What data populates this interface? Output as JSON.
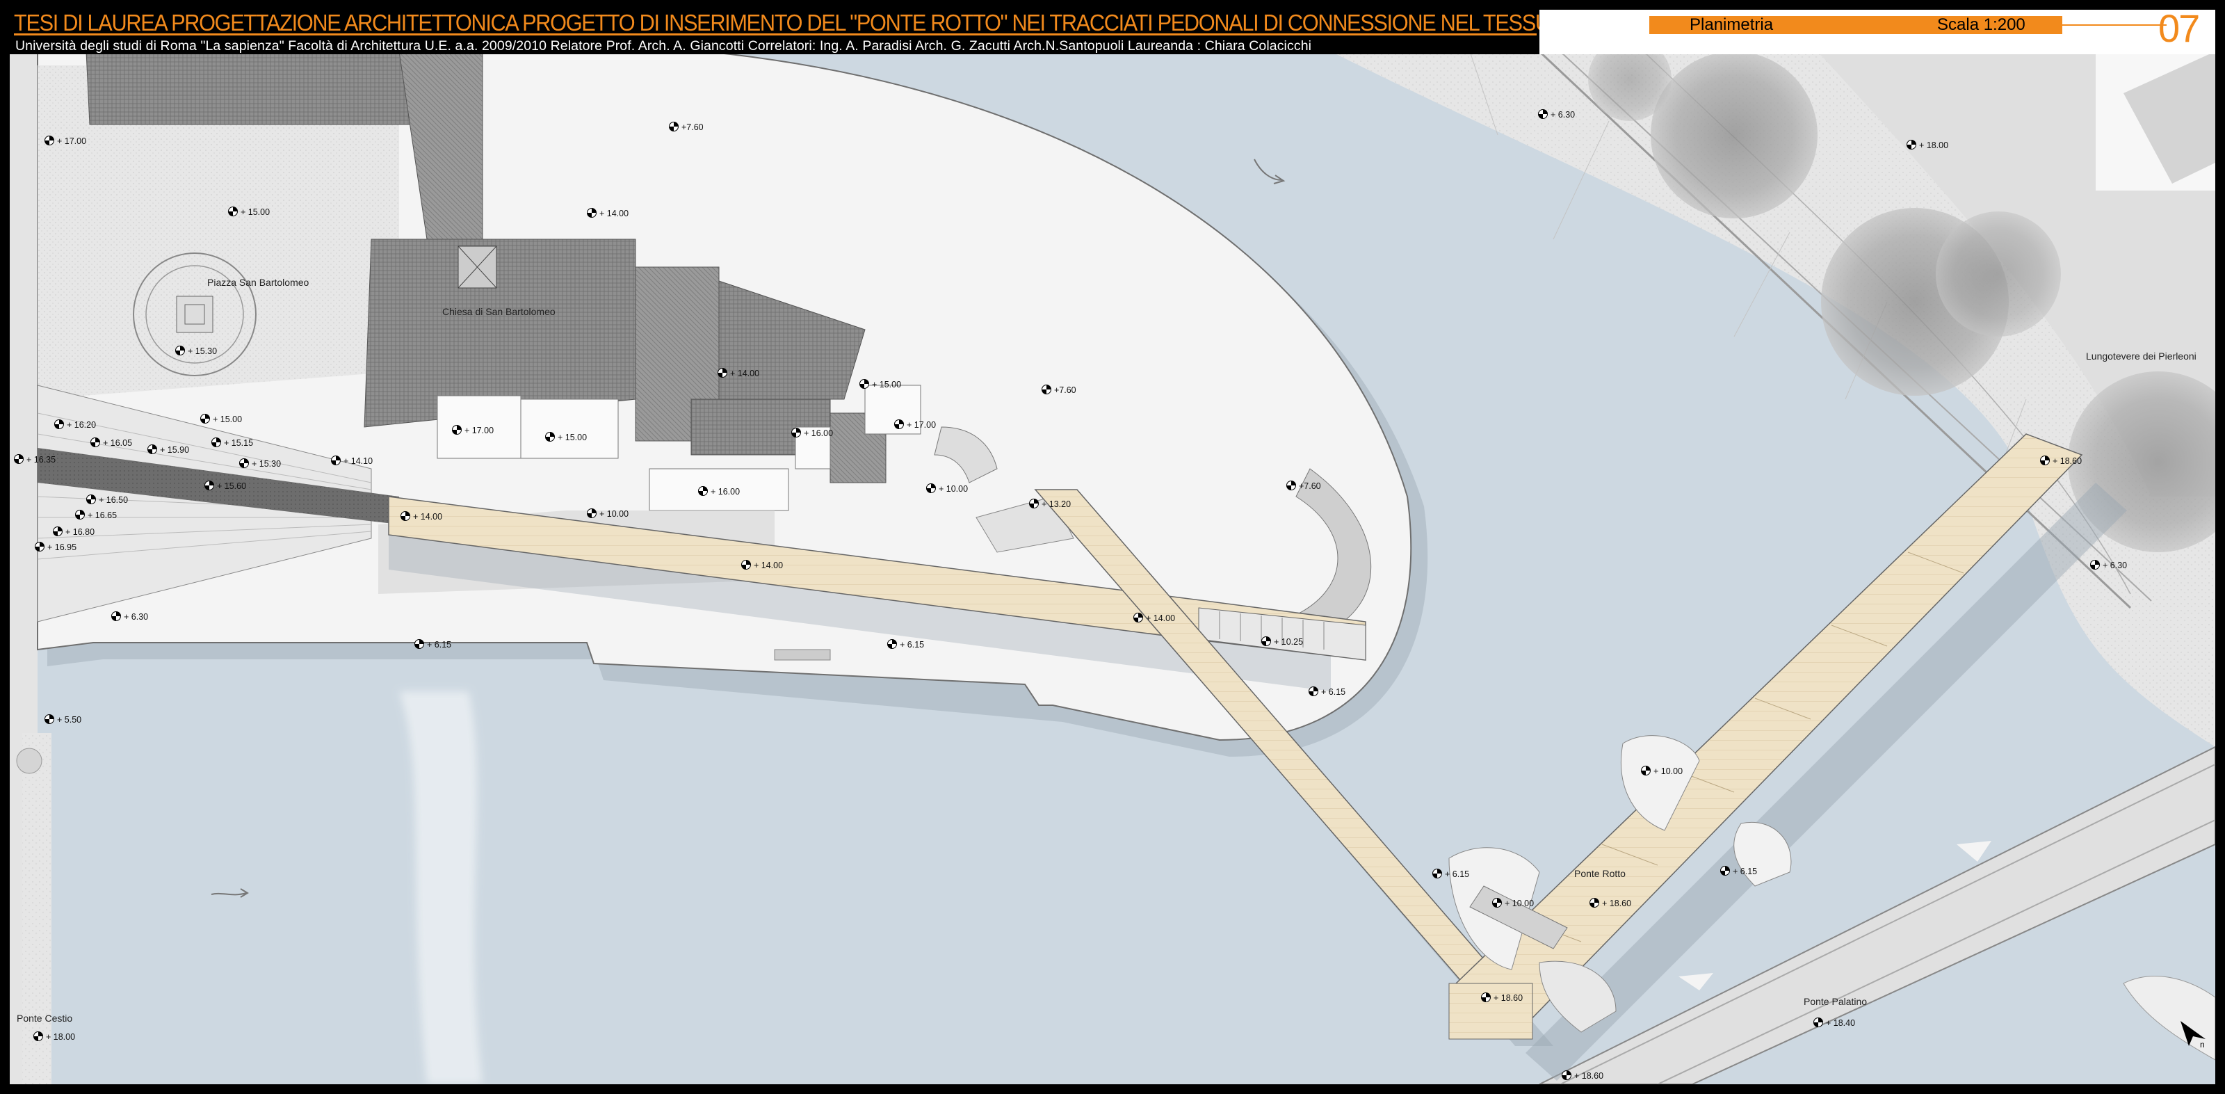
{
  "header": {
    "thesis_title": "TESI DI LAUREA   PROGETTAZIONE ARCHITETTONICA   PROGETTO DI INSERIMENTO DEL \"PONTE ROTTO\" NEI TRACCIATI PEDONALI DI CONNESSIONE NEL TESSUTO URBANO DI ROMA",
    "credits": "Università degli studi di Roma \"La sapienza\" Facoltà di Architettura U.E. a.a. 2009/2010   Relatore Prof. Arch. A. Giancotti   Correlatori:   Ing. A. Paradisi   Arch. G. Zacutti   Arch.N.Santopuoli    Laureanda : Chiara Colacicchi",
    "sheet_name": "Planimetria",
    "sheet_scale": "Scala 1:200",
    "sheet_number": "07"
  },
  "colors": {
    "accent": "#f28a1c",
    "water": "#cdd8e1",
    "island": "#f4f4f4",
    "roof": "#8e8e8e",
    "walkway": "#efe2c6"
  },
  "places": {
    "piazza": "Piazza San Bartolomeo",
    "chiesa": "Chiesa di San Bartolomeo",
    "lungotevere": "Lungotevere dei Pierleoni",
    "ponte_rotto": "Ponte Rotto",
    "ponte_palatino": "Ponte Palatino",
    "ponte_cestio": "Ponte Cestio"
  },
  "elevations": {
    "e01": "+ 17.00",
    "e02": "+7.60",
    "e03": "+ 15.00",
    "e04": "+ 14.00",
    "e05": "+ 6.30",
    "e06": "+ 18.00",
    "e07": "+ 15.30",
    "e08": "+ 14.00",
    "e09": "+ 15.00",
    "e10": "+7.60",
    "e11": "+ 17.00",
    "e12": "+ 16.00",
    "e13": "+ 17.00",
    "e14": "+ 15.00",
    "e15": "+ 15.00",
    "e16": "+ 16.20",
    "e17": "+ 16.05",
    "e18": "+ 15.90",
    "e19": "+ 15.15",
    "e20": "+ 15.30",
    "e21": "+ 14.10",
    "e22": "+ 16.35",
    "e23": "+ 15.60",
    "e24": "+ 16.50",
    "e25": "+ 16.65",
    "e26": "+ 16.80",
    "e27": "+ 16.95",
    "e28": "+ 14.00",
    "e29": "+ 10.00",
    "e30": "+ 10.00",
    "e31": "+ 13.20",
    "e32": "+7.60",
    "e33": "+ 16.00",
    "e34": "+ 14.00",
    "e35": "+ 6.30",
    "e36": "+ 6.15",
    "e37": "+ 6.15",
    "e38": "+ 14.00",
    "e39": "+ 10.25",
    "e40": "+ 6.15",
    "e41": "+ 5.50",
    "e42": "+ 18.60",
    "e43": "+ 6.30",
    "e44": "+ 10.00",
    "e45": "+ 6.15",
    "e46": "+ 6.15",
    "e47": "+ 10.00",
    "e48": "+ 18.60",
    "e49": "+ 18.60",
    "e50": "+ 18.40",
    "e51": "+ 18.60",
    "e52": "+ 18.00"
  },
  "north_label": "n"
}
